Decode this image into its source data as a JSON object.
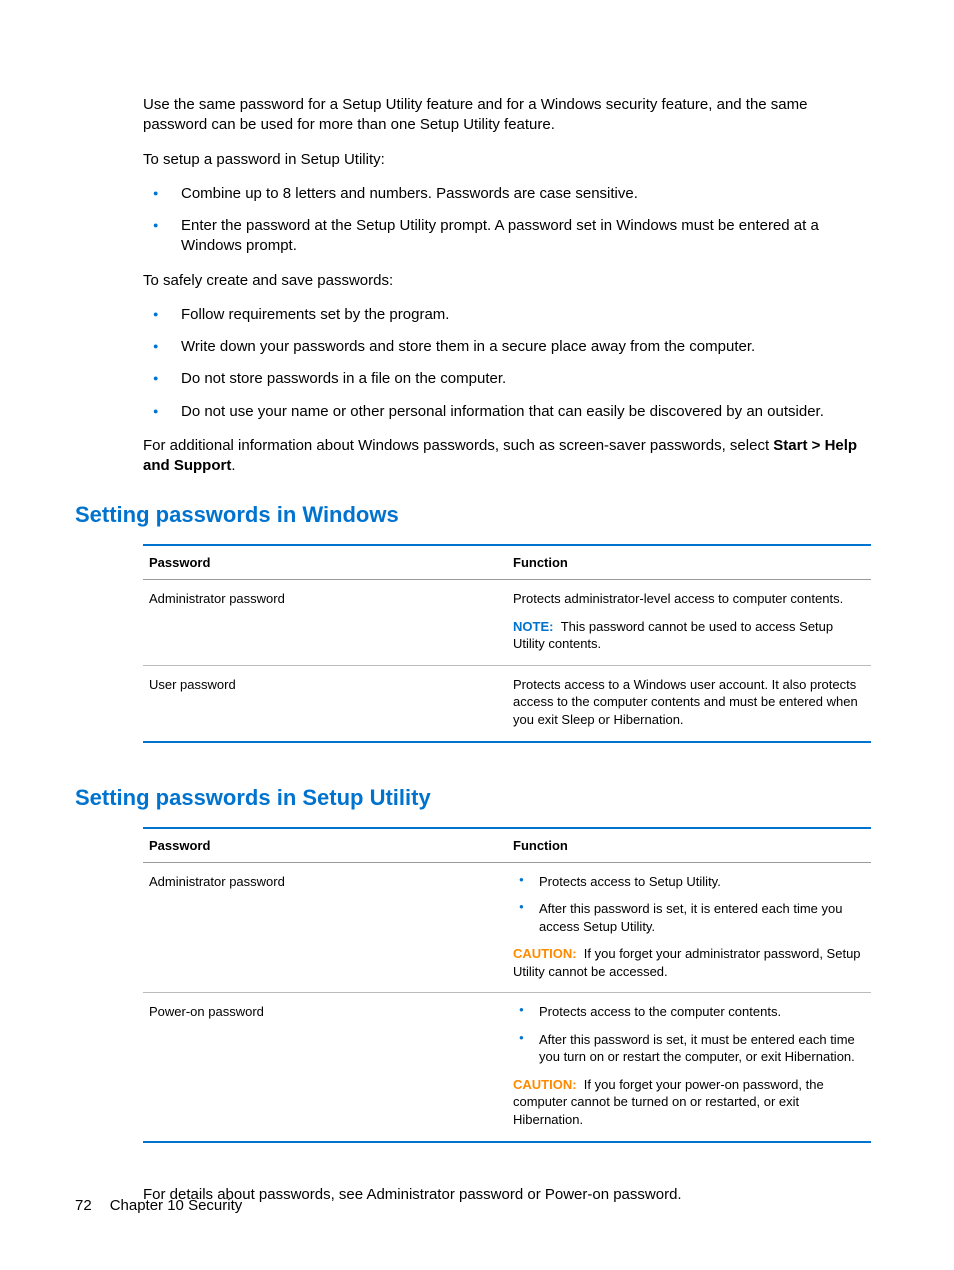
{
  "intro": {
    "p1": "Use the same password for a Setup Utility feature and for a Windows security feature, and the same password can be used for more than one Setup Utility feature.",
    "p2": "To setup a password in Setup Utility:",
    "list1": [
      "Combine up to 8 letters and numbers. Passwords are case sensitive.",
      "Enter the password at the Setup Utility prompt. A password set in Windows must be entered at a Windows prompt."
    ],
    "p3": "To safely create and save passwords:",
    "list2": [
      "Follow requirements set by the program.",
      "Write down your passwords and store them in a secure place away from the computer.",
      "Do not store passwords in a file on the computer.",
      "Do not use your name or other personal information that can easily be discovered by an outsider."
    ],
    "p4_pre": "For additional information about Windows passwords, such as screen-saver passwords, select ",
    "p4_bold": "Start > Help and Support",
    "p4_post": "."
  },
  "section1": {
    "heading": "Setting passwords in Windows",
    "col1": "Password",
    "col2": "Function",
    "rows": [
      {
        "password": "Administrator password",
        "func_text": "Protects administrator-level access to computer contents.",
        "note_label": "NOTE:",
        "note_text": "This password cannot be used to access Setup Utility contents."
      },
      {
        "password": "User password",
        "func_text": "Protects access to a Windows user account. It also protects access to the computer contents and must be entered when you exit Sleep or Hibernation."
      }
    ]
  },
  "section2": {
    "heading": "Setting passwords in Setup Utility",
    "col1": "Password",
    "col2": "Function",
    "rows": [
      {
        "password": "Administrator password",
        "bullets": [
          "Protects access to Setup Utility.",
          "After this password is set, it is entered each time you access Setup Utility."
        ],
        "caution_label": "CAUTION:",
        "caution_text": "If you forget your administrator password, Setup Utility cannot be accessed."
      },
      {
        "password": "Power-on password",
        "bullets": [
          "Protects access to the computer contents.",
          "After this password is set, it must be entered each time you turn on or restart the computer, or exit Hibernation."
        ],
        "caution_label": "CAUTION:",
        "caution_text": "If you forget your power-on password, the computer cannot be turned on or restarted, or exit Hibernation."
      }
    ]
  },
  "closing": "For details about passwords, see Administrator password or Power-on password.",
  "footer": {
    "page": "72",
    "chapter": "Chapter 10   Security"
  }
}
